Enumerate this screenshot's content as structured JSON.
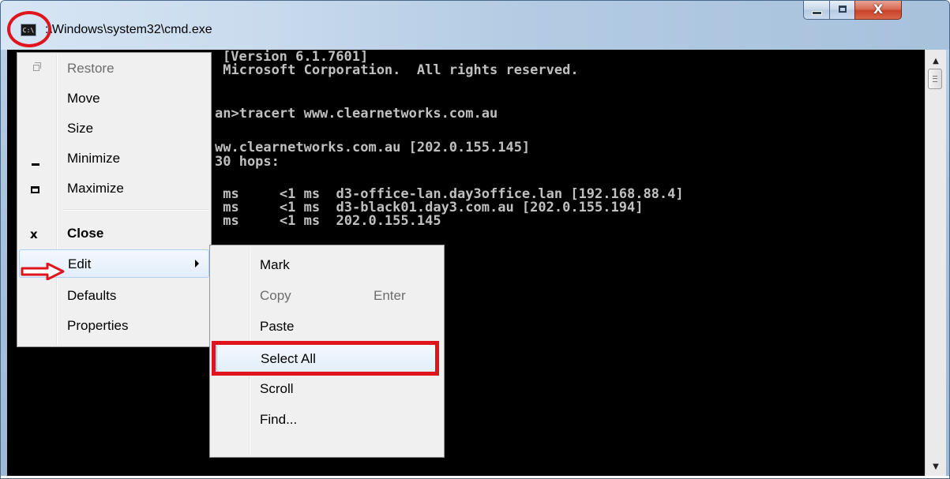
{
  "window": {
    "title": ":\\Windows\\system32\\cmd.exe",
    "app_icon_label": "C:\\",
    "close_glyph": "X"
  },
  "console": {
    "lines": [
      "[Version 6.1.7601]",
      " Microsoft Corporation.  All rights reserved.",
      "an>tracert www.clearnetworks.com.au",
      "ww.clearnetworks.com.au [202.0.155.145]",
      "30 hops:",
      " ms     <1 ms  d3-office-lan.day3office.lan [192.168.88.4]",
      " ms     <1 ms  d3-black01.day3.com.au [202.0.155.194]",
      " ms     <1 ms  202.0.155.145"
    ]
  },
  "system_menu": {
    "items": [
      {
        "label": "Restore",
        "icon": "restore-icon",
        "disabled": true
      },
      {
        "label": "Move",
        "icon": "",
        "disabled": false
      },
      {
        "label": "Size",
        "icon": "",
        "disabled": false
      },
      {
        "label": "Minimize",
        "icon": "minimize-icon",
        "disabled": false
      },
      {
        "label": "Maximize",
        "icon": "maximize-icon",
        "disabled": false
      },
      {
        "label": "Close",
        "icon": "close-icon",
        "disabled": false,
        "bold": true
      },
      {
        "label": "Edit",
        "icon": "",
        "disabled": false,
        "has_submenu": true,
        "active": true
      },
      {
        "label": "Defaults",
        "icon": "",
        "disabled": false
      },
      {
        "label": "Properties",
        "icon": "",
        "disabled": false
      }
    ],
    "close_icon_glyph": "x"
  },
  "edit_submenu": {
    "items": [
      {
        "label": "Mark",
        "accelerator": "",
        "disabled": false
      },
      {
        "label": "Copy",
        "accelerator": "Enter",
        "disabled": true
      },
      {
        "label": "Paste",
        "accelerator": "",
        "disabled": false
      },
      {
        "label": "Select All",
        "accelerator": "",
        "disabled": false,
        "active": true
      },
      {
        "label": "Scroll",
        "accelerator": "",
        "disabled": false
      },
      {
        "label": "Find...",
        "accelerator": "",
        "disabled": false
      }
    ]
  },
  "annotations": {
    "highlight_color": "#e0141c"
  },
  "colors": {
    "console_bg": "#000000",
    "console_fg": "#c0c0c0",
    "menu_bg": "#f0f0f0",
    "menu_hover": "#e3eefa"
  }
}
